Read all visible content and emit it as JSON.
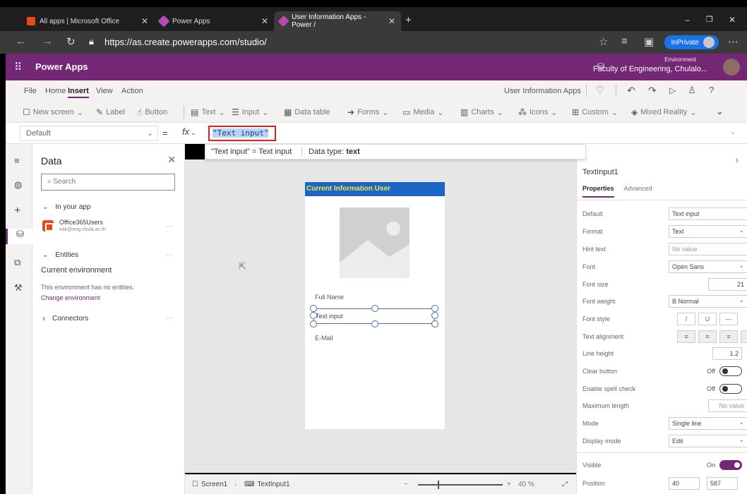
{
  "browser": {
    "tabs": [
      {
        "title": "All apps | Microsoft Office"
      },
      {
        "title": "Power Apps"
      },
      {
        "title": "User Information Apps - Power /"
      }
    ],
    "url": "https://as.create.powerapps.com/studio/",
    "inprivate": "InPrivate"
  },
  "app": {
    "title": "Power Apps",
    "env_label": "Environment",
    "env_value": "Faculty of Engineering, Chulalo..."
  },
  "menu": {
    "items": [
      "File",
      "Home",
      "Insert",
      "View",
      "Action"
    ],
    "app_name": "User Information Apps"
  },
  "ribbon": [
    "New screen",
    "Label",
    "Button",
    "Text",
    "Input",
    "Data table",
    "Forms",
    "Media",
    "Charts",
    "Icons",
    "Custom",
    "Mixed Reality"
  ],
  "formula": {
    "property": "Default",
    "eq": "=",
    "fx": "fx",
    "value": "\"Text input\"",
    "hint_result": "\"Text input\" = Text input",
    "hint_type_label": "Data type:",
    "hint_type": "text"
  },
  "data_panel": {
    "title": "Data",
    "search_placeholder": "Search",
    "in_your_app": "In your app",
    "source_name": "Office365Users",
    "source_sub": "eak@eng.chula.ac.th",
    "entities": "Entities",
    "current_env": "Current environment",
    "no_entities": "This environment has no entities.",
    "change_env": "Change environment",
    "connectors": "Connectors"
  },
  "screen": {
    "header": "Current Information User",
    "full_name": "Full Name",
    "text_input": "Text input",
    "email": "E-Mail"
  },
  "footer": {
    "screen": "Screen1",
    "control": "TextInput1",
    "minus": "−",
    "plus": "+",
    "zoom": "40 %"
  },
  "props": {
    "control_name": "TextInput1",
    "tab_properties": "Properties",
    "tab_advanced": "Advanced",
    "rows": {
      "default": {
        "label": "Default",
        "value": "Text input"
      },
      "format": {
        "label": "Format",
        "value": "Text"
      },
      "hint": {
        "label": "Hint text",
        "value": "No value"
      },
      "font": {
        "label": "Font",
        "value": "Open Sans"
      },
      "font_size": {
        "label": "Font size",
        "value": "21"
      },
      "font_weight": {
        "label": "Font weight",
        "value": "B  Normal"
      },
      "font_style": {
        "label": "Font style",
        "b1": "/",
        "b2": "U",
        "b3": "—"
      },
      "text_align": {
        "label": "Text alignment"
      },
      "line_height": {
        "label": "Line height",
        "value": "1.2"
      },
      "clear": {
        "label": "Clear button",
        "value": "Off"
      },
      "spell": {
        "label": "Enable spell check",
        "value": "Off"
      },
      "maxlen": {
        "label": "Maximum length",
        "value": "No value"
      },
      "mode": {
        "label": "Mode",
        "value": "Single line"
      },
      "display_mode": {
        "label": "Display mode",
        "value": "Edit"
      },
      "visible": {
        "label": "Visible",
        "value": "On"
      },
      "position": {
        "label": "Position",
        "x": "40",
        "y": "587"
      }
    }
  },
  "colors": {
    "brand": "#742774",
    "header_bar": "#1e66c4",
    "header_text": "#f5e642",
    "highlight": "#e02020"
  }
}
